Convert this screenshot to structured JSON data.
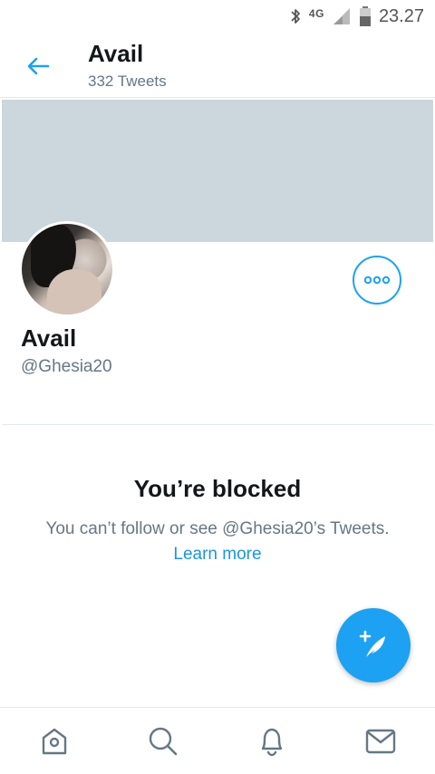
{
  "status_bar": {
    "network": "4G",
    "time": "23.27",
    "icons": [
      "bluetooth-icon",
      "signal-icon",
      "battery-icon"
    ]
  },
  "header": {
    "title": "Avail",
    "subtitle": "332 Tweets",
    "back_icon": "arrow-left-icon"
  },
  "profile": {
    "name": "Avail",
    "handle": "@Ghesia20",
    "more_icon": "more-horizontal-icon"
  },
  "blocked": {
    "title": "You’re blocked",
    "description": "You can’t follow or see @Ghesia20’s Tweets.",
    "learn_more": "Learn more"
  },
  "fab": {
    "icon": "compose-tweet-icon"
  },
  "bottom_nav": {
    "items": [
      {
        "icon": "home-icon"
      },
      {
        "icon": "search-icon"
      },
      {
        "icon": "notifications-icon"
      },
      {
        "icon": "messages-icon"
      }
    ]
  },
  "colors": {
    "accent": "#1da1f2",
    "banner": "#ccd6dd",
    "secondary_text": "#657786",
    "primary_text": "#14171a"
  }
}
